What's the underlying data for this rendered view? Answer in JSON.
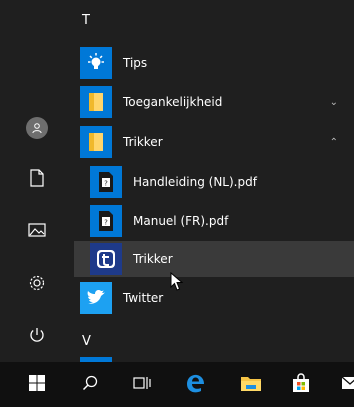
{
  "colors": {
    "accent": "#0078d7",
    "rail_bg": "#1f1f1f",
    "taskbar_bg": "#101010",
    "selected_bg": "#3a3a3a"
  },
  "rail": {
    "items": [
      {
        "name": "user-avatar",
        "icon": "user-icon"
      },
      {
        "name": "documents",
        "icon": "document-icon"
      },
      {
        "name": "pictures",
        "icon": "pictures-icon"
      },
      {
        "name": "settings",
        "icon": "gear-icon"
      },
      {
        "name": "power",
        "icon": "power-icon"
      }
    ]
  },
  "app_list": {
    "groups": [
      {
        "letter": "T"
      },
      {
        "letter": "V"
      }
    ],
    "items": [
      {
        "label": "Tips",
        "icon": "lightbulb-icon"
      },
      {
        "label": "Toegankelijkheid",
        "icon": "folder-icon",
        "chevron": "⌄"
      },
      {
        "label": "Trikker",
        "icon": "folder-icon",
        "chevron": "⌃"
      },
      {
        "label": "Handleiding (NL).pdf",
        "icon": "pdf-document-icon"
      },
      {
        "label": "Manuel (FR).pdf",
        "icon": "pdf-document-icon"
      },
      {
        "label": "Trikker",
        "icon": "trikker-app-icon"
      },
      {
        "label": "Twitter",
        "icon": "twitter-bird-icon"
      }
    ]
  },
  "taskbar": {
    "items": [
      {
        "name": "start",
        "icon": "windows-logo-icon"
      },
      {
        "name": "search",
        "icon": "search-icon"
      },
      {
        "name": "task-view",
        "icon": "task-view-icon"
      },
      {
        "name": "edge",
        "icon": "edge-browser-icon"
      },
      {
        "name": "file-explorer",
        "icon": "folder-icon"
      },
      {
        "name": "store",
        "icon": "store-bag-icon"
      },
      {
        "name": "mail",
        "icon": "mail-icon"
      }
    ]
  }
}
